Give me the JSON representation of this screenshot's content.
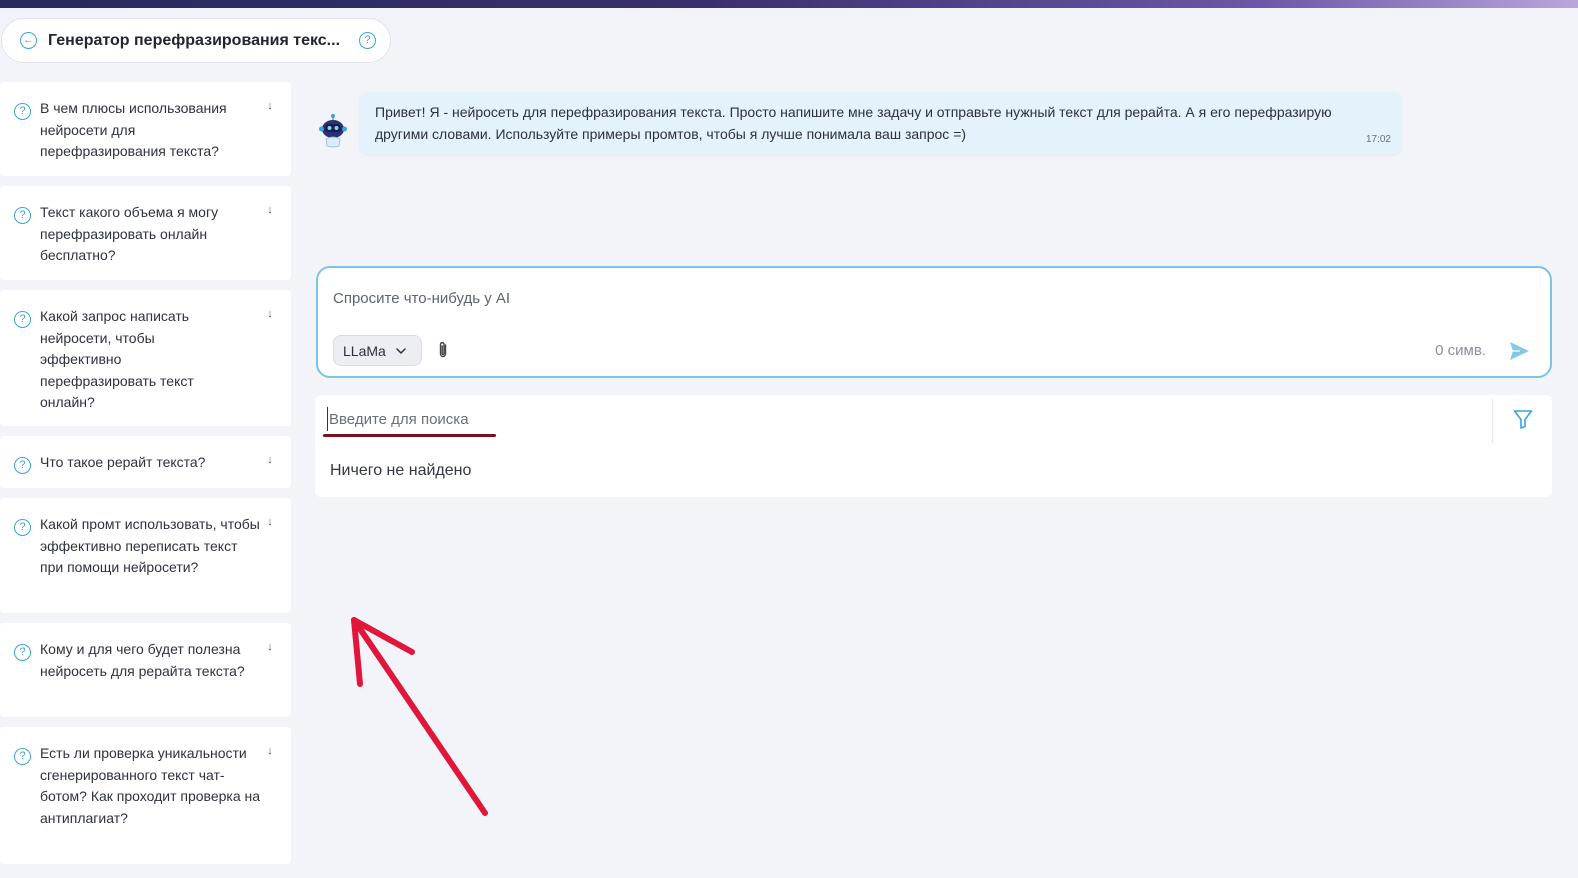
{
  "header": {
    "title": "Генератор перефразирования текс...",
    "back_icon": "arrow-left-circle-icon",
    "help_icon": "question-circle-icon"
  },
  "faq": {
    "items": [
      {
        "question": "В чем плюсы использования нейросети для перефразирования текста?"
      },
      {
        "question": "Текст какого объема я могу перефразировать онлайн бесплатно?"
      },
      {
        "question": "Какой запрос написать нейросети, чтобы эффективно перефразировать текст онлайн?"
      },
      {
        "question": "Что такое рерайт текста?"
      },
      {
        "question": "Какой промт использовать, чтобы эффективно переписать текст при помощи нейросети?"
      },
      {
        "question": "Кому и для чего будет полезна нейросеть для рерайта текста?"
      },
      {
        "question": "Есть ли проверка уникальности сгенерированного текст чат-ботом? Как проходит проверка на антиплагиат?"
      }
    ]
  },
  "chat": {
    "message": "Привет! Я - нейросеть для перефразирования текста. Просто напишите мне задачу и отправьте нужный текст для рерайта. А я его перефразирую другими словами. Используйте примеры промтов, чтобы я лучше понимала ваш запрос =)",
    "time": "17:02"
  },
  "composer": {
    "placeholder": "Спросите что-нибудь у AI",
    "value": "",
    "model": "LLaMa",
    "char_count": "0 симв."
  },
  "search": {
    "placeholder": "Введите для поиска",
    "value": "",
    "empty_text": "Ничего не найдено"
  },
  "colors": {
    "accent": "#3aa3d8",
    "composer_border": "#7ec3e3",
    "bubble_bg": "#e4f3fb",
    "annotation": "#e0163a",
    "underline": "#7a1020"
  }
}
